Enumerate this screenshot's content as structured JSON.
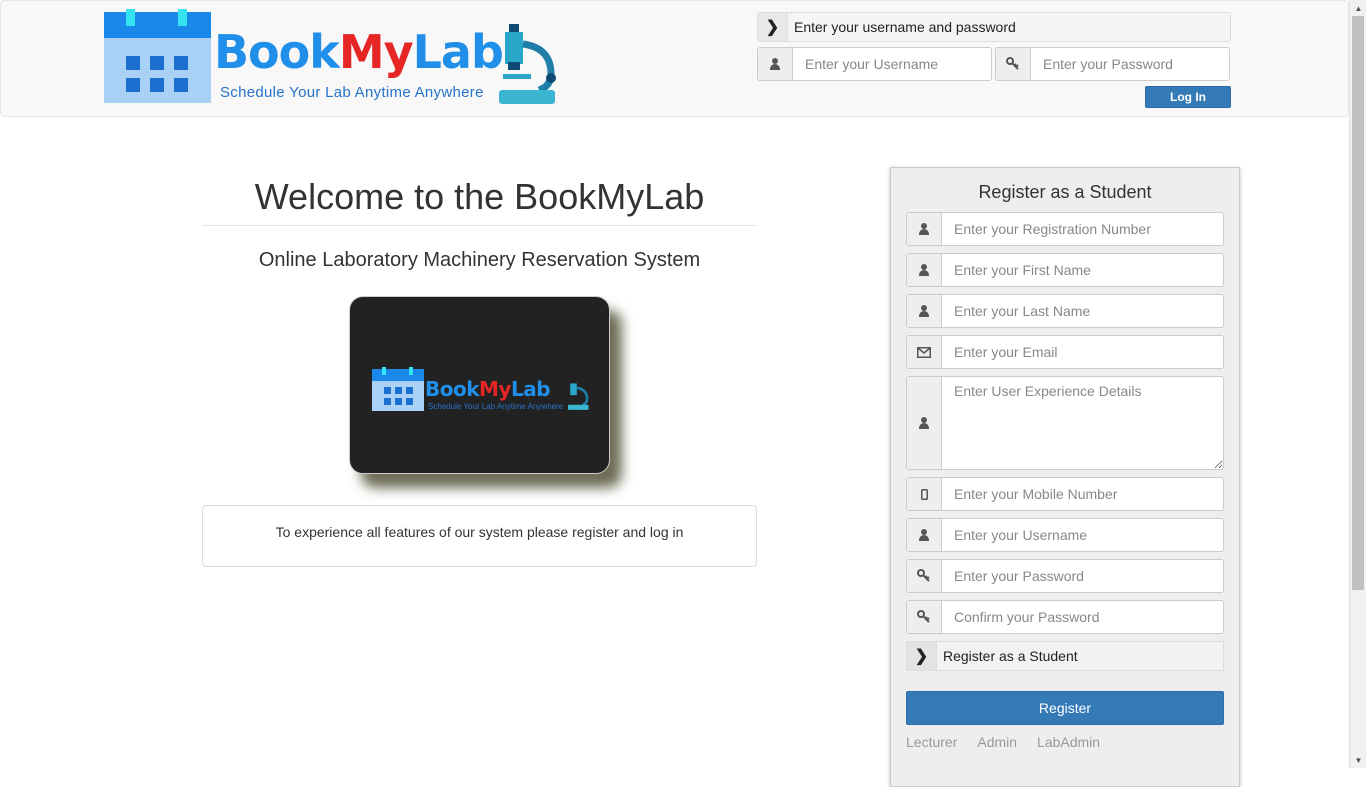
{
  "brand": {
    "word_part1": "Book",
    "word_part2": "My",
    "word_part3": "Lab",
    "tagline": "Schedule Your Lab Anytime Anywhere"
  },
  "login": {
    "caption": "Enter your username and password",
    "username_placeholder": "Enter your Username",
    "password_placeholder": "Enter your Password",
    "button_label": "Log In"
  },
  "main": {
    "welcome": "Welcome to the BookMyLab",
    "subtitle": "Online Laboratory Machinery Reservation System",
    "info": "To experience all features of our system please register and log in"
  },
  "register": {
    "title": "Register as a Student",
    "fields": {
      "reg_number": "Enter your Registration Number",
      "first_name": "Enter your First Name",
      "last_name": "Enter your Last Name",
      "email": "Enter your Email",
      "experience": "Enter User Experience Details",
      "mobile": "Enter your Mobile Number",
      "username": "Enter your Username",
      "password": "Enter your Password",
      "confirm_password": "Confirm your Password"
    },
    "caption": "Register as a Student",
    "button_label": "Register",
    "links": [
      "Lecturer",
      "Admin",
      "LabAdmin"
    ]
  },
  "colors": {
    "primary": "#337ab7",
    "brand_blue": "#1f8fea",
    "brand_red": "#e62525"
  },
  "icons": {
    "user": "user-icon",
    "key": "key-icon",
    "envelope": "envelope-icon",
    "mobile": "mobile-icon",
    "chevron": "chevron-right-icon"
  }
}
